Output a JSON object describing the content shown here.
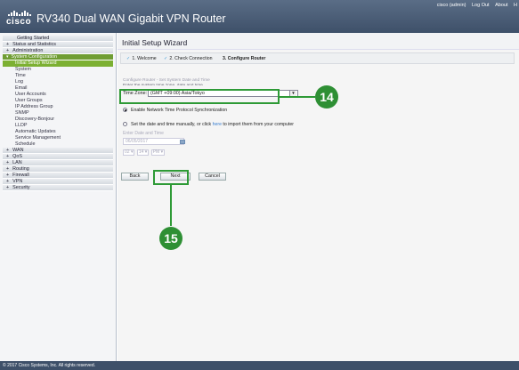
{
  "header": {
    "logo_text": "cisco",
    "title": "RV340 Dual WAN Gigabit VPN Router",
    "user": "cisco (admin)",
    "logout": "Log Out",
    "about": "About",
    "help": "H"
  },
  "sidebar": {
    "getting_started": "Getting Started",
    "status": "Status and Statistics",
    "administration": "Administration",
    "system_configuration": "System Configuration",
    "sub_items": [
      "Initial Setup Wizard",
      "System",
      "Time",
      "Log",
      "Email",
      "User Accounts",
      "User Groups",
      "IP Address Group",
      "SNMP",
      "Discovery-Bonjour",
      "LLDP",
      "Automatic Updates",
      "Service Management",
      "Schedule"
    ],
    "groups": [
      "WAN",
      "QoS",
      "LAN",
      "Routing",
      "Firewall",
      "VPN",
      "Security"
    ]
  },
  "content": {
    "title": "Initial Setup Wizard",
    "steps": [
      "1. Welcome",
      "2. Check Connection",
      "3. Configure Router"
    ],
    "section_title": "Configure Router - Set System Date and Time",
    "section_desc": "Enter the system time zone, date and time.",
    "time_zone_label": "Time Zone:",
    "time_zone_value": "(GMT +09:00) Asia/Tokyo",
    "ntp_option": "Enable Network Time Protocol Synchronization",
    "manual_option_pre": "Set the date and time manually, or click ",
    "manual_option_link": "here",
    "manual_option_post": " to import them from your computer",
    "enter_date_label": "Enter Date and Time",
    "date_value": "06/05/2017",
    "hour": "02",
    "minute": "14",
    "ampm": "PM",
    "buttons": {
      "back": "Back",
      "next": "Next",
      "cancel": "Cancel"
    }
  },
  "callouts": {
    "tz": "14",
    "next": "15"
  },
  "footer": "© 2017 Cisco Systems, Inc. All rights reserved.",
  "colors": {
    "header": "#4a5d78",
    "accent_green": "#6f9d33",
    "callout": "#2e8f34"
  }
}
